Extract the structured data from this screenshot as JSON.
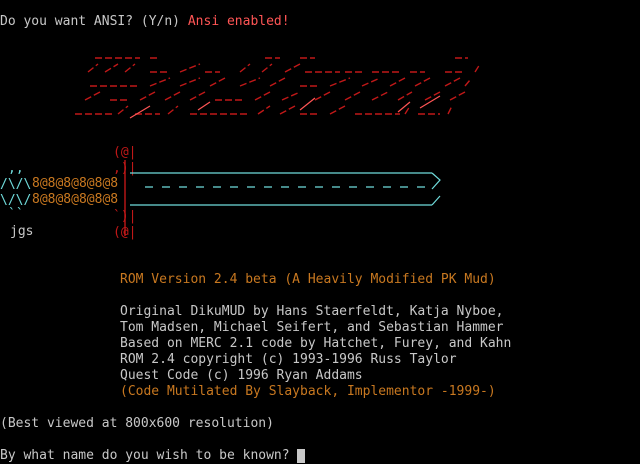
{
  "ansi_prompt": {
    "question": "Do you want ANSI? (Y/n) ",
    "response": "Ansi enabled!"
  },
  "ascii_art": {
    "sword_chain": "8@8@8@8@8@8",
    "signature": "jgs"
  },
  "rom_version": "ROM Version 2.4 beta (A Heavily Modified PK Mud)",
  "credits": [
    "Original DikuMUD by Hans Staerfeldt, Katja Nyboe,",
    "Tom Madsen, Michael Seifert, and Sebastian Hammer",
    "Based on MERC 2.1 code by Hatchet, Furey, and Kahn",
    "ROM 2.4 copyright (c) 1993-1996 Russ Taylor",
    "Quest Code (c) 1996 Ryan Addams"
  ],
  "implementor_note": "(Code Mutilated By Slayback, Implementor -1999-)",
  "resolution_note": "(Best viewed at 800x600 resolution)",
  "name_prompt": "By what name do you wish to be known?",
  "colors": {
    "background": "#000000",
    "text": "#c8c8c8",
    "highlight": "#ff5555",
    "dark_red": "#c01818",
    "orange": "#c87820",
    "cyan": "#70dcdc"
  }
}
